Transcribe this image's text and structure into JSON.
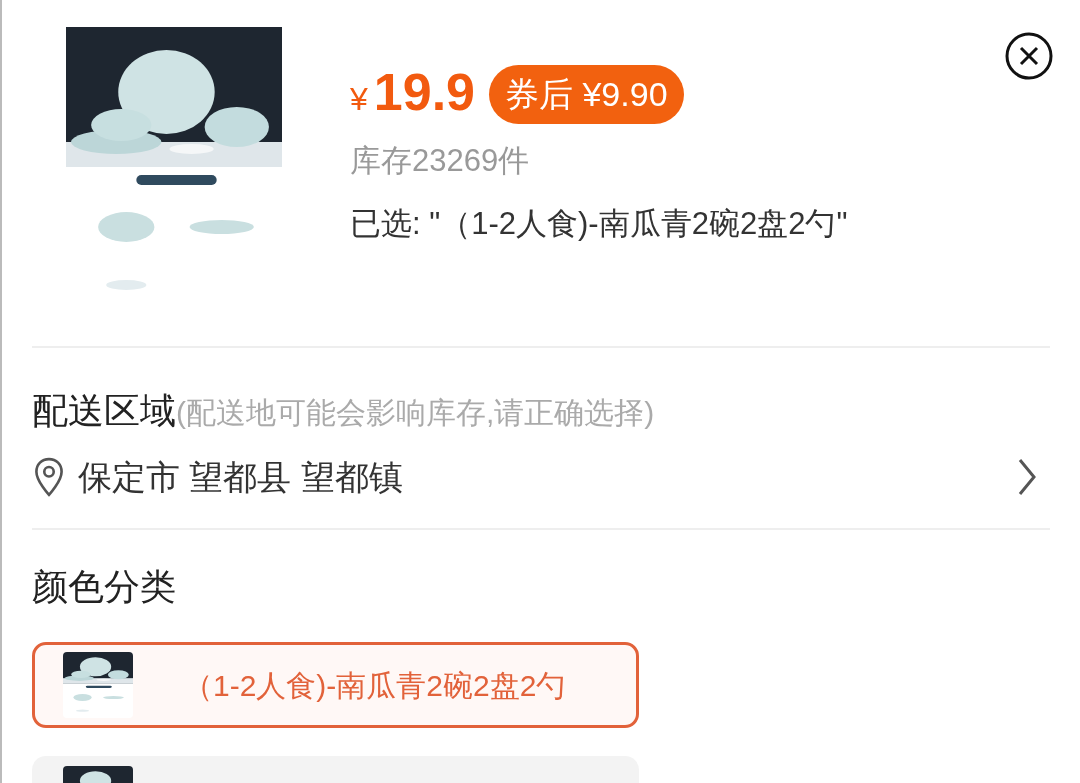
{
  "product": {
    "currency": "¥",
    "price": "19.9",
    "coupon_price": "券后 ¥9.90",
    "stock": "库存23269件",
    "selected_text": "已选: \"（1-2人食)-南瓜青2碗2盘2勺\""
  },
  "delivery": {
    "title": "配送区域",
    "hint": "(配送地可能会影响库存,请正确选择)",
    "location": "保定市 望都县 望都镇"
  },
  "color_section": {
    "title": "颜色分类",
    "options": [
      {
        "label": "（1-2人食)-南瓜青2碗2盘2勺",
        "selected": true
      },
      {
        "selected": false
      }
    ]
  }
}
